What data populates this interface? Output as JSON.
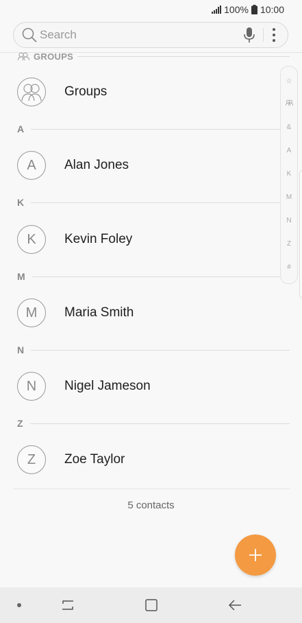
{
  "status": {
    "battery": "100%",
    "time": "10:00"
  },
  "search": {
    "placeholder": "Search"
  },
  "groups_header": "GROUPS",
  "groups_item": {
    "label": "Groups"
  },
  "sections": [
    {
      "letter": "A",
      "contact": {
        "initial": "A",
        "name": "Alan Jones"
      }
    },
    {
      "letter": "K",
      "contact": {
        "initial": "K",
        "name": "Kevin Foley"
      }
    },
    {
      "letter": "M",
      "contact": {
        "initial": "M",
        "name": "Maria Smith"
      }
    },
    {
      "letter": "N",
      "contact": {
        "initial": "N",
        "name": "Nigel Jameson"
      }
    },
    {
      "letter": "Z",
      "contact": {
        "initial": "Z",
        "name": "Zoe Taylor"
      }
    }
  ],
  "index_items": [
    "☆",
    "",
    "&",
    "A",
    "K",
    "M",
    "N",
    "Z",
    "#"
  ],
  "footer": {
    "count": "5 contacts"
  },
  "colors": {
    "accent": "#f39a42"
  }
}
